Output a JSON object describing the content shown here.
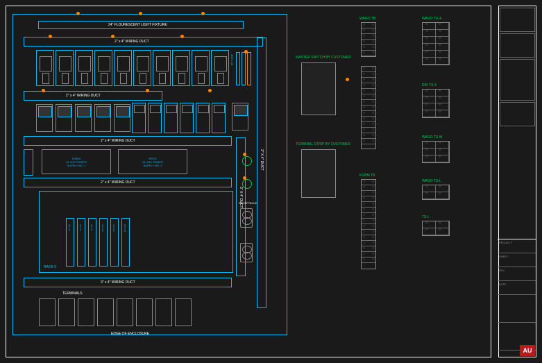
{
  "drawing": {
    "light_fixture": "24\" FLOURESCENT LIGHT FIXTURE",
    "wiring_duct_2x4": "2\" x 4\" WIRING DUCT",
    "wiring_duct_3x4": "3\" x 4\" WIRING DUCT",
    "duct_2x4_v": "2\" X 4\" DUCT",
    "duct_3x4_v": "3\" X 4\" DUCT",
    "edge": "EDGE OF ENCLOSURE",
    "rack": "RACK 0",
    "terminals": "TERMINALS",
    "receptacle": "RECEPTACLE",
    "ps1_name": "RSEM",
    "ps1_desc": "24 VDC PWSPS",
    "ps1_sub": "SUPPLY NO. 1",
    "ps2_name": "RPCS",
    "ps2_desc": "24 VDC PWSPS",
    "ps2_sub": "SUPPLY NO. 2",
    "card_labels": [
      "AI1732",
      "AI1732",
      "AI1732",
      "AO1732",
      "AO1732",
      "DO1732"
    ],
    "ann_master": "MASTER SWITCH BY CUSTOMER",
    "ann_terminal": "TERMINAL STRIP BY CUSTOMER",
    "jdx_lux": "JDX LUX"
  },
  "terminal_blocks": {
    "tb1": "WAGO TB",
    "tb2": "KGBM TB",
    "stb1": "WAGO TS-4",
    "stb2": "DIN TS-4",
    "stb3": "WAGO TS-M",
    "stb4": "WAGO TS-L",
    "stb5": "TS-L"
  },
  "title_block": {
    "r1": "PROJECT",
    "r2": "SHEET",
    "r3": "REV",
    "r4": "DATE",
    "badge": "AU"
  }
}
